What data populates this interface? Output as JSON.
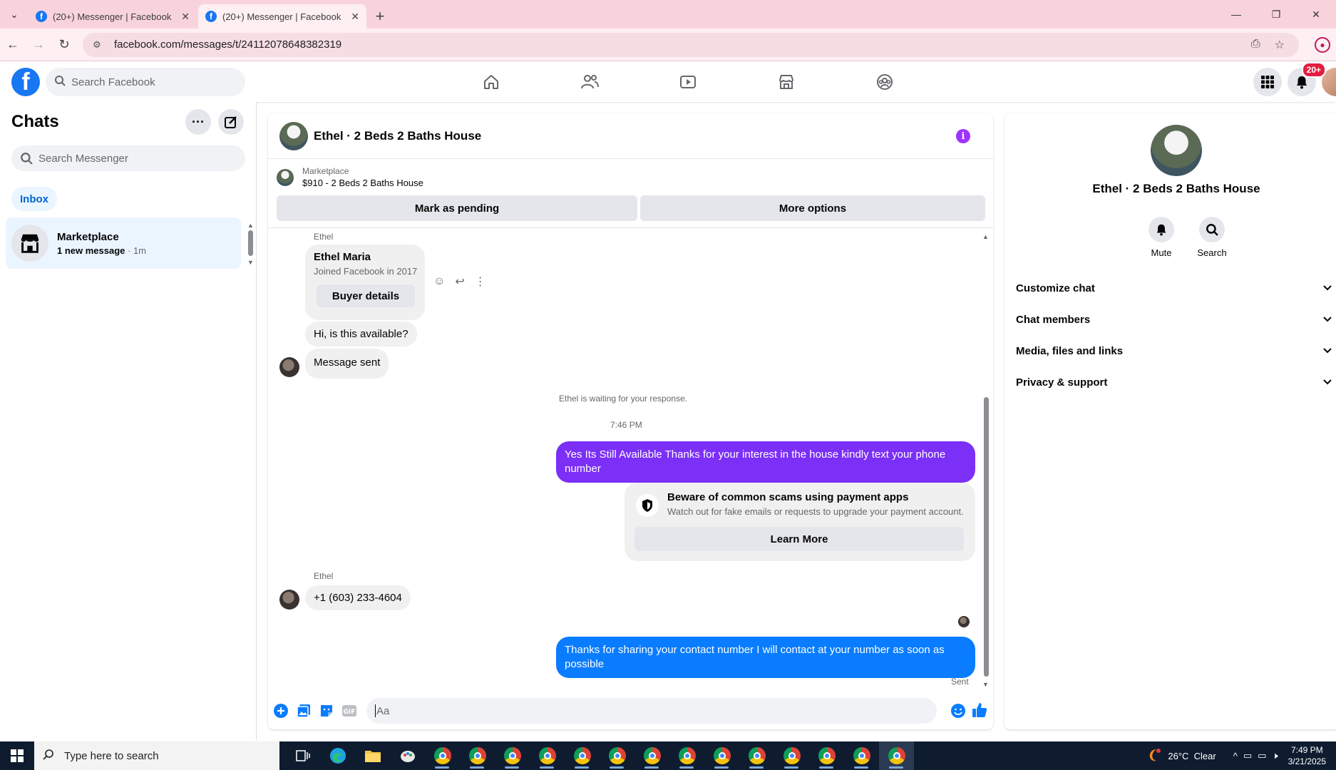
{
  "browser": {
    "tabs": [
      {
        "title": "(20+) Messenger | Facebook"
      },
      {
        "title": "(20+) Messenger | Facebook"
      }
    ],
    "url": "facebook.com/messages/t/24112078648382319"
  },
  "fb_header": {
    "search_placeholder": "Search Facebook",
    "notification_badge": "20+"
  },
  "sidebar": {
    "title": "Chats",
    "search_placeholder": "Search Messenger",
    "filter": "Inbox",
    "chat": {
      "name": "Marketplace",
      "unread": "1 new message",
      "sep": " · ",
      "time": "1m"
    }
  },
  "conversation": {
    "title": "Ethel · 2 Beds 2 Baths House",
    "marketplace_label": "Marketplace",
    "listing": "$910 - 2 Beds 2 Baths House",
    "mark_pending": "Mark as pending",
    "more_options": "More options",
    "messages": {
      "sender1": "Ethel",
      "buyer_name": "Ethel Maria",
      "buyer_joined": "Joined Facebook in 2017",
      "buyer_details": "Buyer details",
      "msg1": "Hi, is this available?",
      "msg2": "Message sent",
      "waiting": "Ethel is waiting for your response.",
      "time": "7:46 PM",
      "out1": "Yes Its Still Available Thanks for your interest in the house kindly  text your phone number",
      "scam_title": "Beware of common scams using payment apps",
      "scam_sub": "Watch out for fake emails or requests to upgrade your payment account.",
      "learn_more": "Learn More",
      "sender2": "Ethel",
      "phone": "+1 (603) 233-4604",
      "out2": "Thanks for sharing your contact number I will contact at your number as soon as possible",
      "sent": "Sent"
    },
    "composer_placeholder": "Aa"
  },
  "info_panel": {
    "name": "Ethel · 2 Beds 2 Baths House",
    "actions": [
      {
        "label": "Mute"
      },
      {
        "label": "Search"
      }
    ],
    "sections": [
      {
        "label": "Customize chat"
      },
      {
        "label": "Chat members"
      },
      {
        "label": "Media, files and links"
      },
      {
        "label": "Privacy & support"
      }
    ]
  },
  "taskbar": {
    "search_placeholder": "Type here to search",
    "weather": "26°C  Clear",
    "time": "7:49 PM",
    "date": "3/21/2025"
  },
  "colors": {
    "accent_purple": "#7b2ff7",
    "messenger_blue": "#0a7cff",
    "facebook_blue": "#1877f2",
    "badge_red": "#e41e3f"
  }
}
